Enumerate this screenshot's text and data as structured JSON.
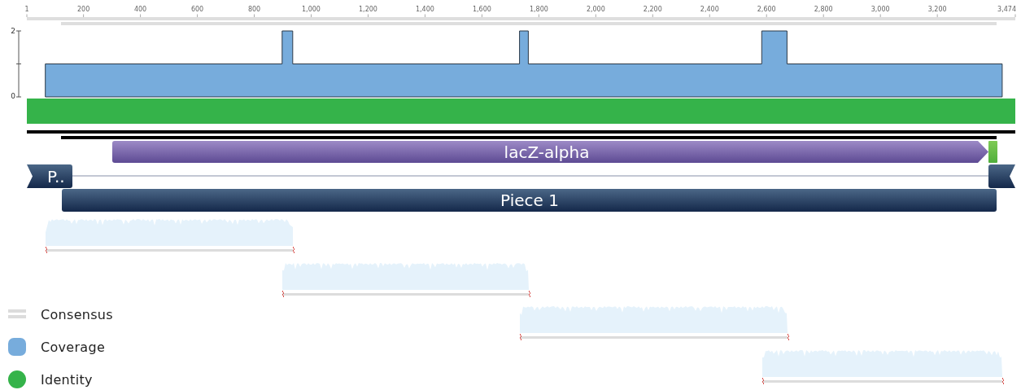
{
  "coverage": {
    "chart_data": {
      "type": "area",
      "x": [
        66,
        66,
        898,
        898,
        935,
        935,
        1732,
        1732,
        1763,
        1763,
        2583,
        2583,
        2672,
        2672,
        3428,
        3428
      ],
      "series": [
        {
          "color": "#77acdc",
          "values": [
            0,
            1,
            1,
            2,
            2,
            1,
            1,
            2,
            2,
            1,
            1,
            2,
            2,
            1,
            1,
            0
          ]
        }
      ],
      "xlim": [
        1,
        3474
      ],
      "ylim": [
        0,
        2
      ],
      "yticks": [
        0,
        2
      ],
      "xticks": [
        {
          "value": 1,
          "label": "1"
        },
        {
          "value": 200,
          "label": "200"
        },
        {
          "value": 400,
          "label": "400"
        },
        {
          "value": 600,
          "label": "600"
        },
        {
          "value": 800,
          "label": "800"
        },
        {
          "value": 1000,
          "label": "1,000"
        },
        {
          "value": 1200,
          "label": "1,200"
        },
        {
          "value": 1400,
          "label": "1,400"
        },
        {
          "value": 1600,
          "label": "1,600"
        },
        {
          "value": 1800,
          "label": "1,800"
        },
        {
          "value": 2000,
          "label": "2,000"
        },
        {
          "value": 2200,
          "label": "2,200"
        },
        {
          "value": 2400,
          "label": "2,400"
        },
        {
          "value": 2600,
          "label": "2,600"
        },
        {
          "value": 2800,
          "label": "2,800"
        },
        {
          "value": 3000,
          "label": "3,000"
        },
        {
          "value": 3200,
          "label": "3,200"
        },
        {
          "value": 3474,
          "label": "3,474"
        }
      ]
    }
  },
  "annotations": [
    {
      "label": "lacZ-alpha",
      "kind": "gene"
    },
    {
      "kind": "marker"
    },
    {
      "label": "P..",
      "kind": "wrap"
    },
    {
      "label": "Piece 1",
      "kind": "piece"
    }
  ],
  "legend": [
    {
      "label": "Consensus",
      "kind": "bars",
      "color": "#dcdcdc"
    },
    {
      "label": "Coverage",
      "kind": "square",
      "color": "#77acdc"
    },
    {
      "label": "Identity",
      "kind": "dot",
      "color": "#35b34a"
    }
  ]
}
